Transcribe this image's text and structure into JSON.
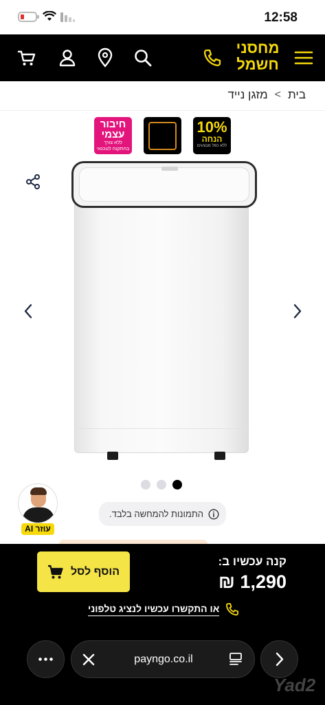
{
  "status_bar": {
    "time": "12:58"
  },
  "header": {
    "logo_line1": "מחסני",
    "logo_line2": "חשמל",
    "icons": [
      "menu-icon",
      "phone-icon",
      "search-icon",
      "location-icon",
      "user-icon",
      "cart-icon"
    ]
  },
  "breadcrumb": {
    "home": "בית",
    "separator": ">",
    "current": "מזגן נייד"
  },
  "badges": {
    "self_connect_title_1": "חיבור",
    "self_connect_title_2": "עצמי",
    "self_connect_sub_1": "ללא צורך",
    "self_connect_sub_2": "בהתקנה לטכנאי",
    "discount_percent": "10%",
    "discount_label": "הנחה",
    "discount_note": "ללא כפל מבצעים"
  },
  "gallery": {
    "dot_count": 3,
    "active_dot_index": 2
  },
  "disclaimer": {
    "text": "התמונות להמחשה בלבד."
  },
  "ai_assistant": {
    "label": "עוזר AI"
  },
  "purchase": {
    "buy_now_label": "קנה עכשיו ב:",
    "price": "1,290 ₪",
    "add_to_cart_label": "הוסף לסל",
    "contact_text": "או התקשרו עכשיו לנציג טלפוני"
  },
  "browser": {
    "url": "payngo.co.il"
  },
  "watermark": "Yad2",
  "colors": {
    "brand_yellow": "#f5d90a",
    "cart_button": "#f5e446",
    "badge_pink": "#e3157d",
    "header_bg": "#000000"
  }
}
